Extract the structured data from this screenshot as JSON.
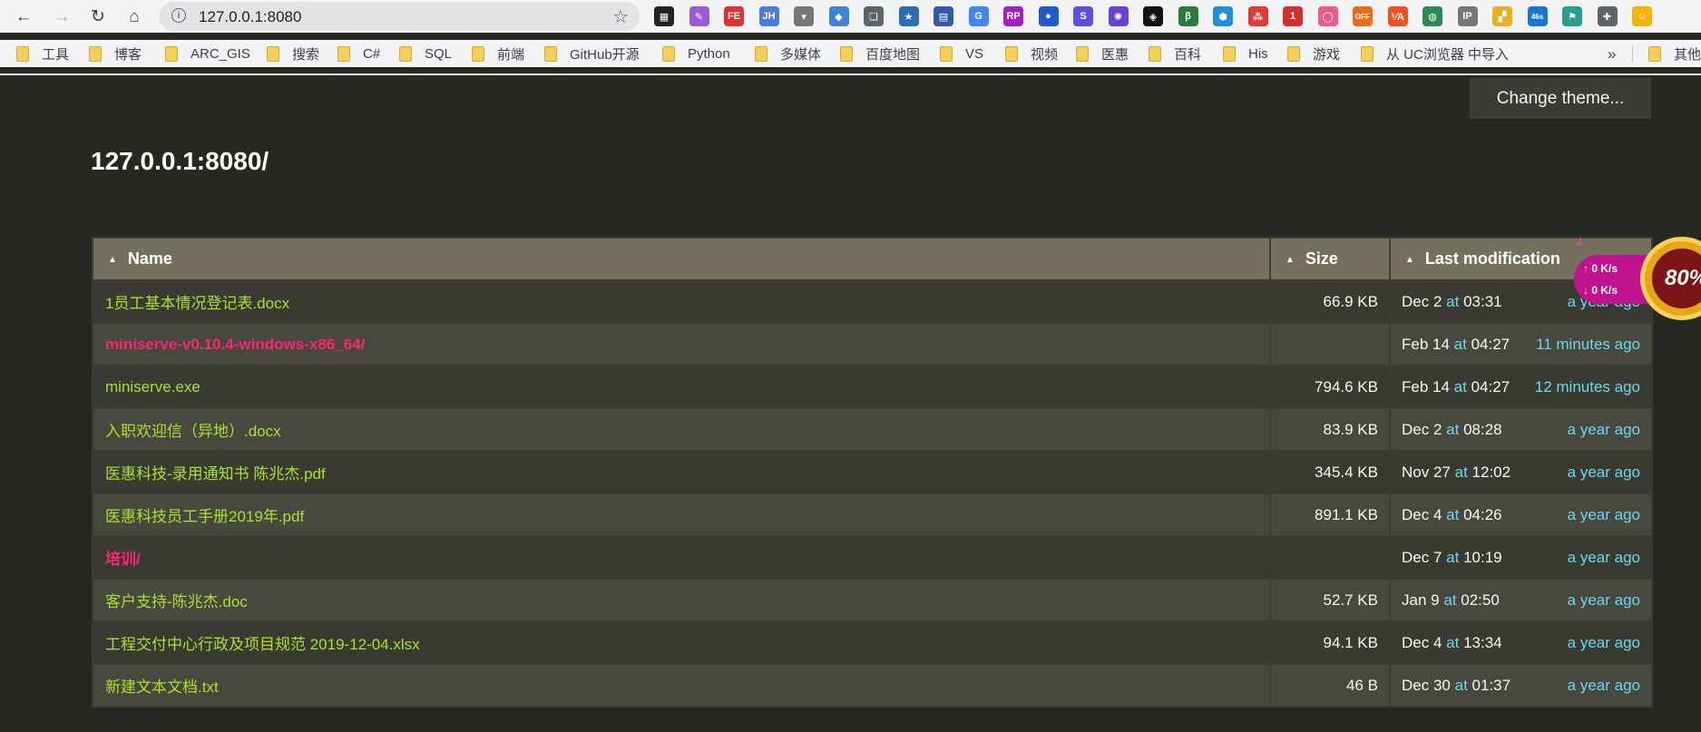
{
  "browser": {
    "url": "127.0.0.1:8080",
    "extensions": [
      {
        "name": "qr-code-icon",
        "label": "▦",
        "color": "#222222"
      },
      {
        "name": "quill-icon",
        "label": "✎",
        "color": "#9c5bd6"
      },
      {
        "name": "fe-helper-icon",
        "label": "FE",
        "color": "#e03030"
      },
      {
        "name": "jh-icon",
        "label": "JH",
        "color": "#4a7be0"
      },
      {
        "name": "overflow-chevron-icon",
        "label": "▾",
        "color": "#777777"
      },
      {
        "name": "apps-grid-icon",
        "label": "◆",
        "color": "#3e83d8"
      },
      {
        "name": "bookmark-icon",
        "label": "❏",
        "color": "#5f6368"
      },
      {
        "name": "star-manager-icon",
        "label": "★",
        "color": "#2c6bb5"
      },
      {
        "name": "window-icon",
        "label": "▤",
        "color": "#3559a8"
      },
      {
        "name": "translate-icon",
        "label": "G",
        "color": "#4285f4"
      },
      {
        "name": "rp-icon",
        "label": "RP",
        "color": "#a31fc2"
      },
      {
        "name": "firefox-like-icon",
        "label": "●",
        "color": "#1e5bd0"
      },
      {
        "name": "s-swirl-icon",
        "label": "S",
        "color": "#5b4ee0"
      },
      {
        "name": "sun-gear-icon",
        "label": "✺",
        "color": "#6a3fd6"
      },
      {
        "name": "layers-icon",
        "label": "◈",
        "color": "#111111"
      },
      {
        "name": "leaf-icon",
        "label": "β",
        "color": "#2a7c3e"
      },
      {
        "name": "hexagon-icon",
        "label": "⬢",
        "color": "#1f8fe0"
      },
      {
        "name": "red-dice-icon",
        "label": "⁂",
        "color": "#e53935"
      },
      {
        "name": "todo-badge-icon",
        "label": "1",
        "color": "#d32f2f"
      },
      {
        "name": "ring-icon",
        "label": "◯",
        "color": "#e85a8a"
      },
      {
        "name": "off-icon",
        "label": "OFF",
        "color": "#f06a1a"
      },
      {
        "name": "va-icon",
        "label": "⅟A",
        "color": "#f25022"
      },
      {
        "name": "globe-icon",
        "label": "◍",
        "color": "#2e8b57"
      },
      {
        "name": "ip-icon",
        "label": "IP",
        "color": "#777777"
      },
      {
        "name": "color-palette-icon",
        "label": "▞",
        "color": "#e8b020"
      },
      {
        "name": "timer-icon",
        "label": "46s",
        "color": "#1976d2"
      },
      {
        "name": "paint-icon",
        "label": "⚑",
        "color": "#2a9d8f"
      },
      {
        "name": "puzzle-icon",
        "label": "✚",
        "color": "#5f6368"
      },
      {
        "name": "profile-avatar-icon",
        "label": "☺",
        "color": "#f5b400"
      }
    ],
    "bookmarks": [
      "工具",
      "博客",
      "ARC_GIS",
      "搜索",
      "C#",
      "SQL",
      "前端",
      "GitHub开源",
      "Python",
      "多媒体",
      "百度地图",
      "VS",
      "视频",
      "医惠",
      "百科",
      "His",
      "游戏",
      "从 UC浏览器 中导入"
    ],
    "bookmarks_more": "»",
    "bookmarks_other": "其他书签"
  },
  "page": {
    "theme_button": "Change theme...",
    "title": "127.0.0.1:8080/",
    "sort_arrow": "▲",
    "columns": {
      "name": "Name",
      "size": "Size",
      "modified": "Last modification"
    },
    "at_word": "at",
    "files": [
      {
        "name": "1员工基本情况登记表.docx",
        "is_dir": false,
        "size": "66.9 KB",
        "date": "Dec 2",
        "time": "03:31",
        "ago": "a year ago"
      },
      {
        "name": "miniserve-v0.10.4-windows-x86_64/",
        "is_dir": true,
        "size": "",
        "date": "Feb 14",
        "time": "04:27",
        "ago": "11 minutes ago"
      },
      {
        "name": "miniserve.exe",
        "is_dir": false,
        "size": "794.6 KB",
        "date": "Feb 14",
        "time": "04:27",
        "ago": "12 minutes ago"
      },
      {
        "name": "入职欢迎信（异地）.docx",
        "is_dir": false,
        "size": "83.9 KB",
        "date": "Dec 2",
        "time": "08:28",
        "ago": "a year ago"
      },
      {
        "name": "医惠科技-录用通知书 陈兆杰.pdf",
        "is_dir": false,
        "size": "345.4 KB",
        "date": "Nov 27",
        "time": "12:02",
        "ago": "a year ago"
      },
      {
        "name": "医惠科技员工手册2019年.pdf",
        "is_dir": false,
        "size": "891.1 KB",
        "date": "Dec 4",
        "time": "04:26",
        "ago": "a year ago"
      },
      {
        "name": "培训/",
        "is_dir": true,
        "size": "",
        "date": "Dec 7",
        "time": "10:19",
        "ago": "a year ago"
      },
      {
        "name": "客户支持-陈兆杰.doc",
        "is_dir": false,
        "size": "52.7 KB",
        "date": "Jan 9",
        "time": "02:50",
        "ago": "a year ago"
      },
      {
        "name": "工程交付中心行政及项目规范 2019-12-04.xlsx",
        "is_dir": false,
        "size": "94.1 KB",
        "date": "Dec 4",
        "time": "13:34",
        "ago": "a year ago"
      },
      {
        "name": "新建文本文档.txt",
        "is_dir": false,
        "size": "46 B",
        "date": "Dec 30",
        "time": "01:37",
        "ago": "a year ago"
      }
    ]
  },
  "speed_widget": {
    "upload": "0 K/s",
    "download": "0 K/s",
    "percent": "80%"
  }
}
